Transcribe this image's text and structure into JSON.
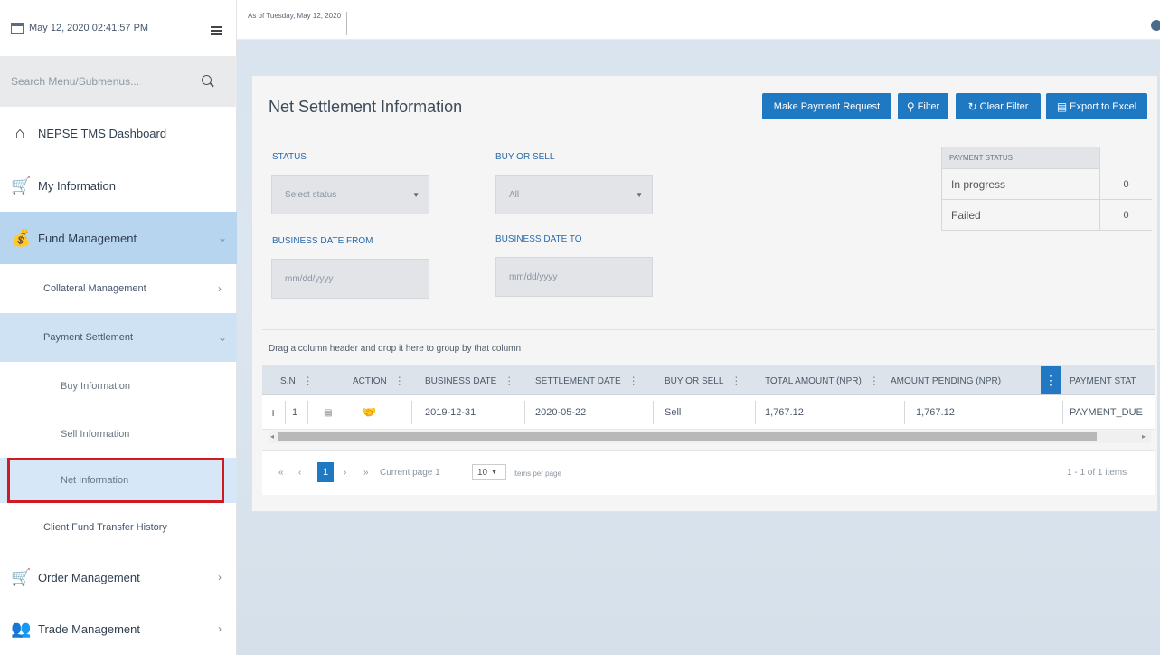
{
  "sidebar": {
    "datetime": "May 12, 2020 02:41:57 PM",
    "search_placeholder": "Search Menu/Submenus...",
    "items": [
      {
        "label": "NEPSE TMS Dashboard",
        "icon": "home-icon"
      },
      {
        "label": "My Information",
        "icon": "cart-icon"
      },
      {
        "label": "Fund Management",
        "icon": "money-bag-icon",
        "chevron": "⌄"
      },
      {
        "label": "Collateral Management",
        "chevron": "›"
      },
      {
        "label": "Payment Settlement",
        "chevron": "⌄"
      },
      {
        "label": "Buy Information"
      },
      {
        "label": "Sell Information"
      },
      {
        "label": "Net Information"
      },
      {
        "label": "Client Fund Transfer History"
      },
      {
        "label": "Order Management",
        "icon": "cart-icon",
        "chevron": "›"
      },
      {
        "label": "Trade Management",
        "icon": "people-icon",
        "chevron": "›"
      }
    ]
  },
  "topbar": {
    "as_of": "As of Tuesday, May 12, 2020"
  },
  "main": {
    "title": "Net Settlement Information",
    "buttons": {
      "make_payment": "Make Payment Request",
      "filter": "Filter",
      "clear_filter": "Clear Filter",
      "export": "Export to Excel"
    },
    "filters": {
      "status_label": "STATUS",
      "status_value": "Select status",
      "buy_sell_label": "BUY OR SELL",
      "buy_sell_value": "All",
      "date_from_label": "BUSINESS DATE FROM",
      "date_from_placeholder": "mm/dd/yyyy",
      "date_to_label": "BUSINESS DATE TO",
      "date_to_placeholder": "mm/dd/yyyy"
    },
    "payment_status": {
      "header": "PAYMENT STATUS",
      "rows": [
        {
          "label": "In progress",
          "value": "0"
        },
        {
          "label": "Failed",
          "value": "0"
        }
      ]
    },
    "group_hint": "Drag a column header and drop it here to group by that column",
    "grid": {
      "columns": [
        "S.N",
        "ACTION",
        "BUSINESS DATE",
        "SETTLEMENT DATE",
        "BUY OR SELL",
        "TOTAL AMOUNT (NPR)",
        "AMOUNT PENDING (NPR)",
        "PAYMENT STAT"
      ],
      "rows": [
        {
          "expand": "+",
          "sn": "1",
          "business_date": "2019-12-31",
          "settlement_date": "2020-05-22",
          "buy_or_sell": "Sell",
          "total_amount": "1,767.12",
          "amount_pending": "1,767.12",
          "payment_status": "PAYMENT_DUE"
        }
      ]
    },
    "pager": {
      "first": "«",
      "prev": "‹",
      "page": "1",
      "next": "›",
      "last": "»",
      "current_page_text": "Current page 1",
      "page_size": "10",
      "items_per_page": "items per page",
      "summary": "1 - 1 of 1 items"
    }
  }
}
